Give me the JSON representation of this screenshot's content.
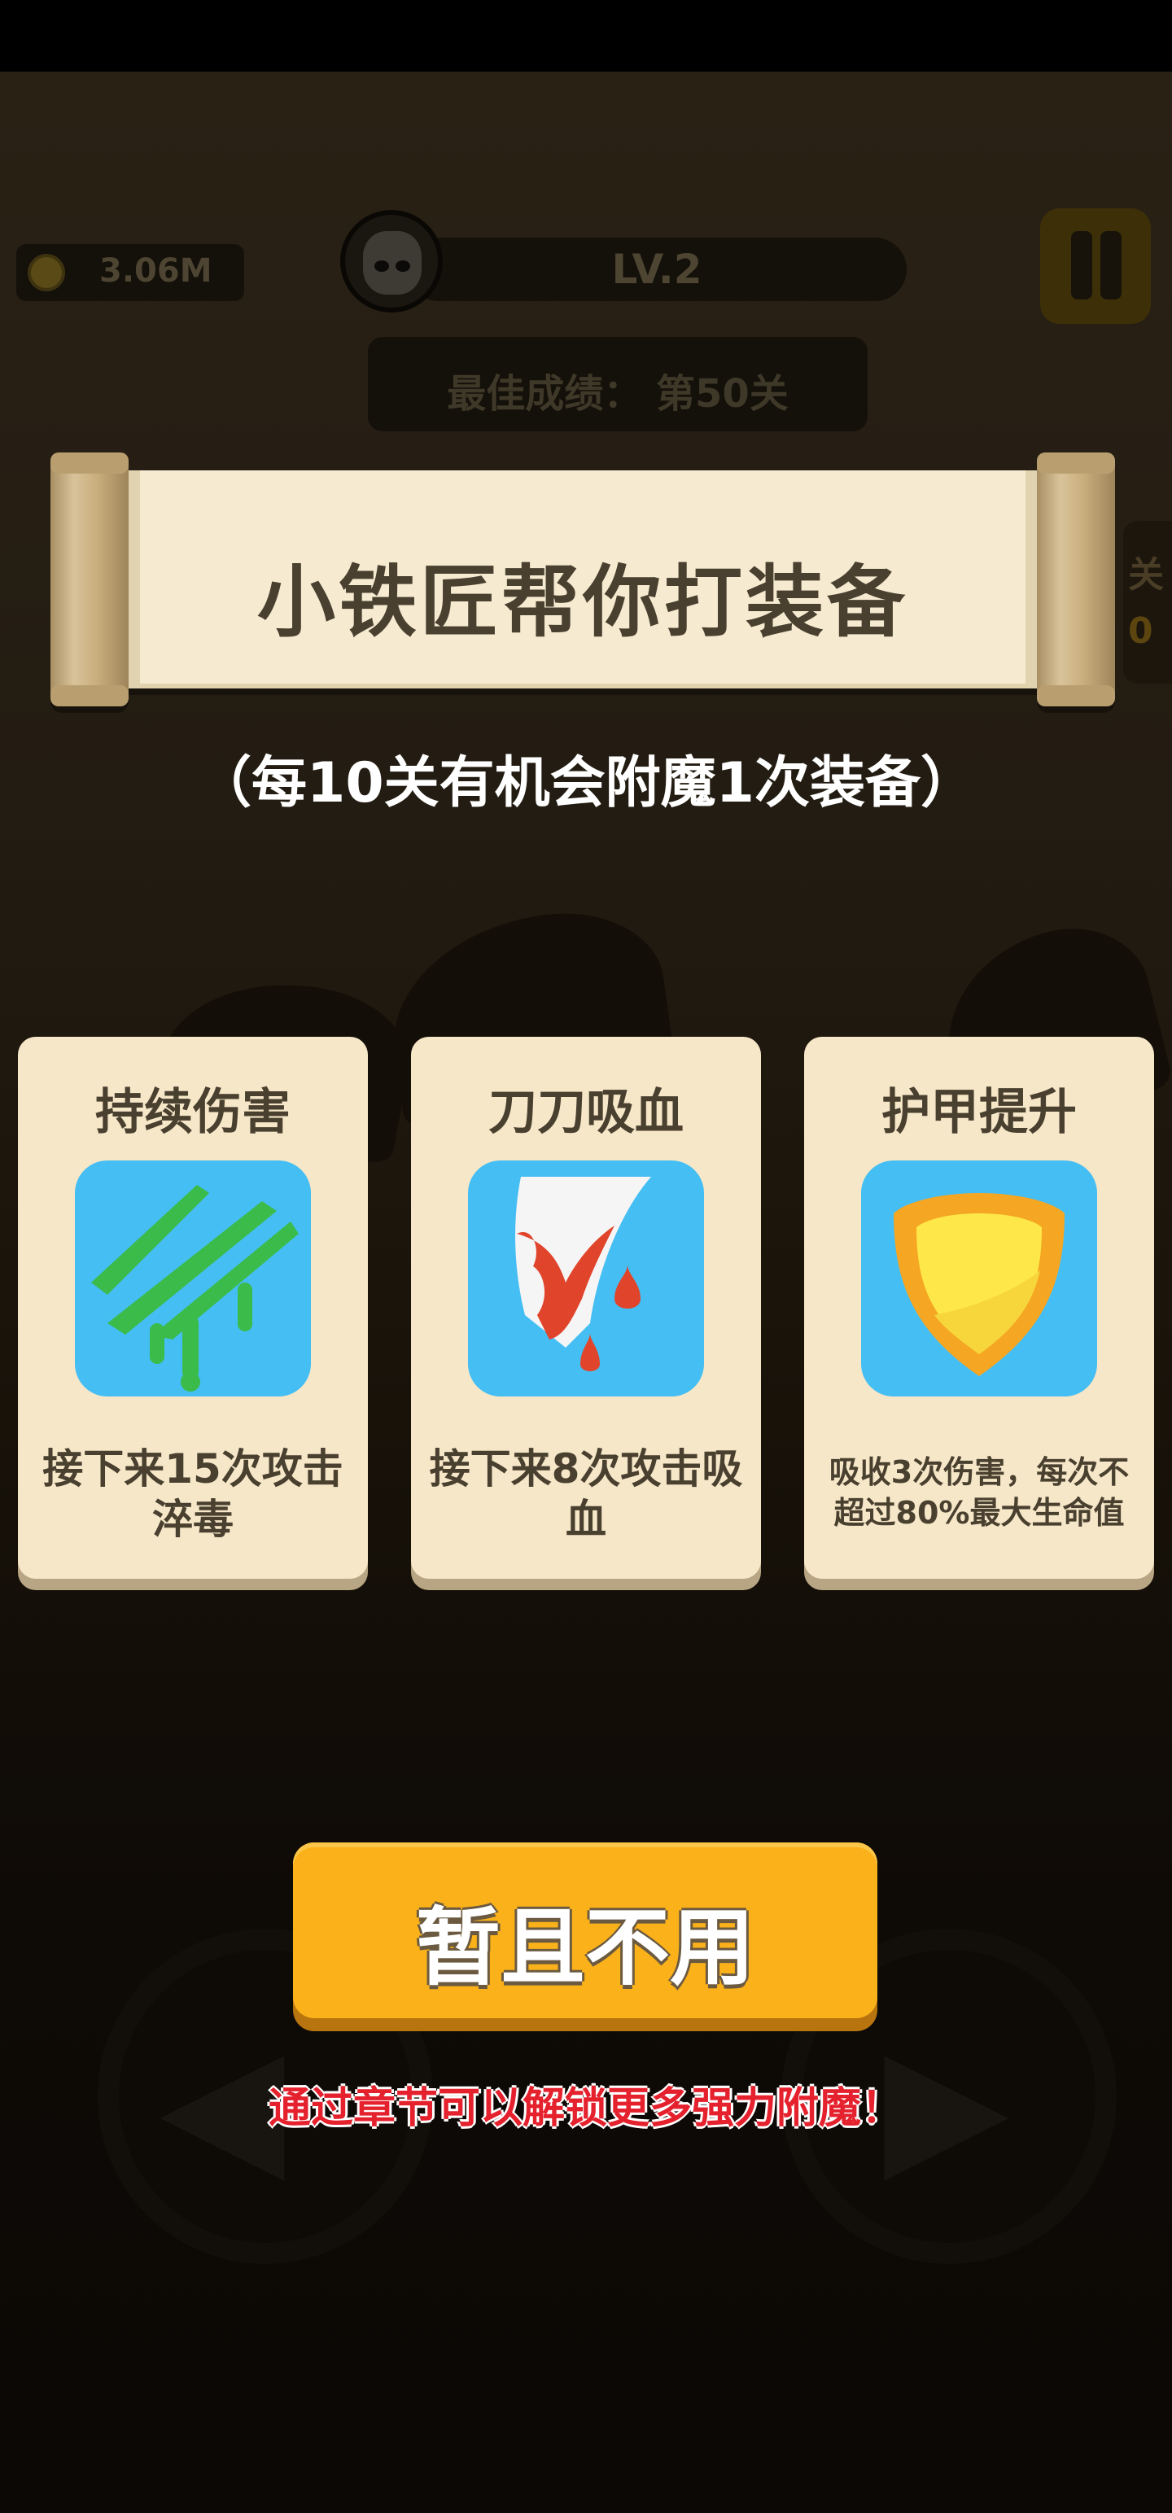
{
  "hud": {
    "coins": "3.06M",
    "level": "LV.2",
    "best": "最佳成绩：  第50关",
    "side_tab_label": "关",
    "side_tab_value": "0"
  },
  "dialog": {
    "title": "小铁匠帮你打装备",
    "subtitle": "（每10关有机会附魔1次装备）",
    "cards": [
      {
        "title": "持续伤害",
        "icon": "green-slash-icon",
        "desc": "接下来15次攻击淬毒"
      },
      {
        "title": "刀刀吸血",
        "icon": "bloody-blade-icon",
        "desc": "接下来8次攻击吸血"
      },
      {
        "title": "护甲提升",
        "icon": "yellow-shield-icon",
        "desc": "吸收3次伤害，每次不超过80%最大生命值"
      }
    ],
    "skip_button": "暂且不用",
    "hint": "通过章节可以解锁更多强力附魔！"
  },
  "colors": {
    "accent": "#fbb119",
    "card": "#f6e7c8",
    "icon_bg": "#45bef3",
    "hint": "#e4212d"
  }
}
